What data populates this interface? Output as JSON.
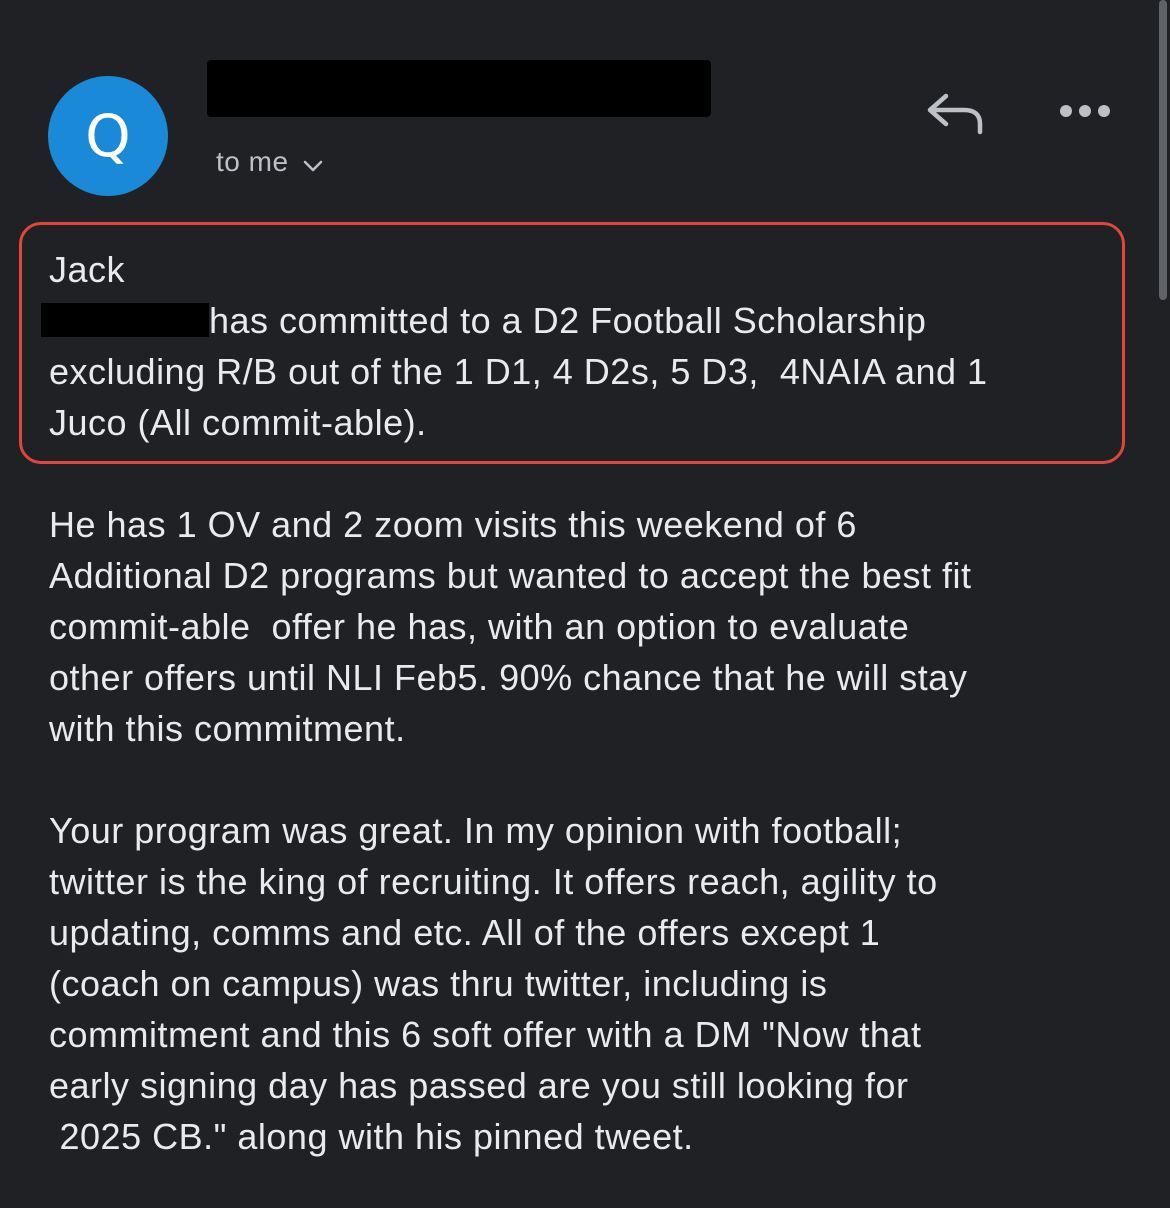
{
  "header": {
    "avatar_letter": "Q",
    "recipient_label": "to me",
    "accent_color": "#1a8ad8"
  },
  "actions": {
    "reply_icon": "reply-icon",
    "more_icon": "more-horizontal-icon"
  },
  "highlighted": {
    "greeting": "Jack",
    "line1": "has committed to a D2 Football Scholarship",
    "line2": "excluding R/B out of the 1 D1, 4 D2s, 5 D3,  4NAIA and 1",
    "line3": "Juco (All commit-able).",
    "border_color": "#e0463d"
  },
  "paragraph1": [
    "He has 1 OV and 2 zoom visits this weekend of 6",
    "Additional D2 programs but wanted to accept the best fit",
    "commit-able  offer he has, with an option to evaluate",
    "other offers until NLI Feb5. 90% chance that he will stay",
    "with this commitment."
  ],
  "paragraph2": [
    "Your program was great. In my opinion with football;",
    "twitter is the king of recruiting. It offers reach, agility to",
    "updating, comms and etc. All of the offers except 1",
    "(coach on campus) was thru twitter, including is",
    "commitment and this 6 soft offer with a DM \"Now that",
    "early signing day has passed are you still looking for",
    " 2025 CB.\" along with his pinned tweet."
  ]
}
